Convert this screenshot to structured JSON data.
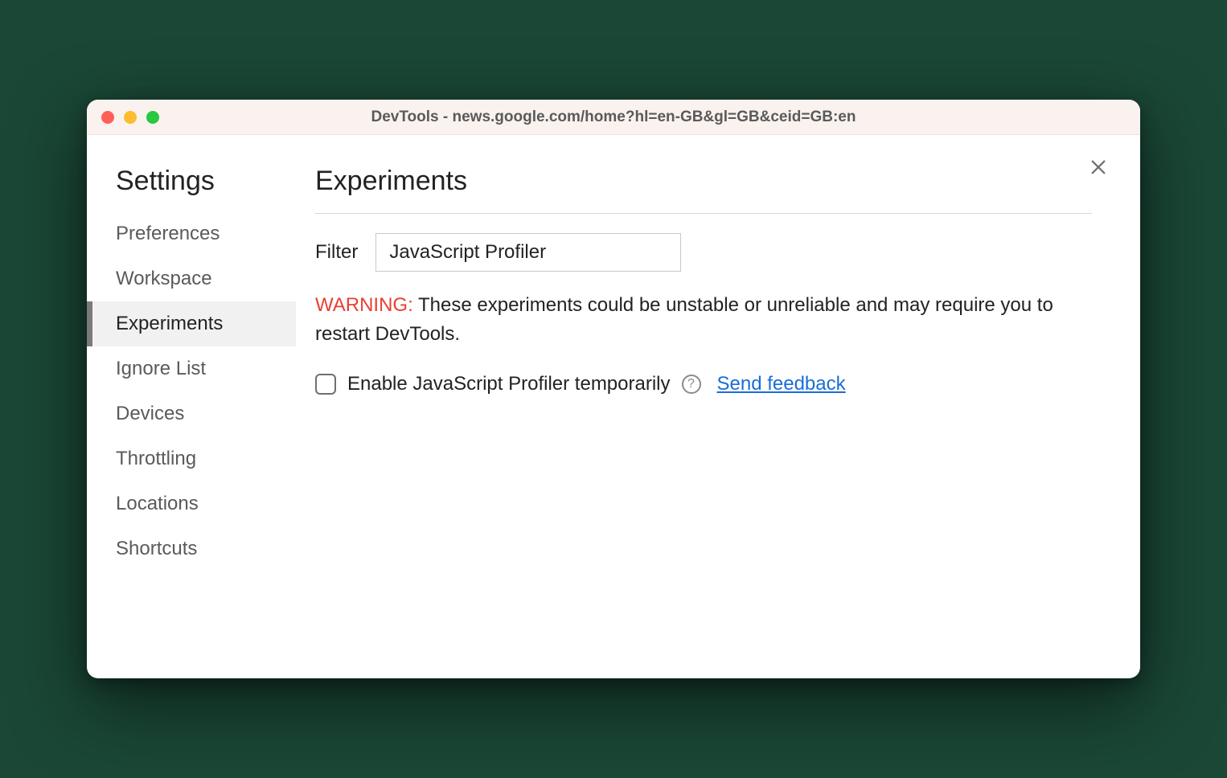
{
  "window": {
    "title": "DevTools - news.google.com/home?hl=en-GB&gl=GB&ceid=GB:en"
  },
  "sidebar": {
    "title": "Settings",
    "items": [
      {
        "label": "Preferences",
        "selected": false
      },
      {
        "label": "Workspace",
        "selected": false
      },
      {
        "label": "Experiments",
        "selected": true
      },
      {
        "label": "Ignore List",
        "selected": false
      },
      {
        "label": "Devices",
        "selected": false
      },
      {
        "label": "Throttling",
        "selected": false
      },
      {
        "label": "Locations",
        "selected": false
      },
      {
        "label": "Shortcuts",
        "selected": false
      }
    ]
  },
  "main": {
    "title": "Experiments",
    "filter_label": "Filter",
    "filter_value": "JavaScript Profiler",
    "warning_label": "WARNING:",
    "warning_text": " These experiments could be unstable or unreliable and may require you to restart DevTools.",
    "experiment": {
      "checked": false,
      "label": "Enable JavaScript Profiler temporarily",
      "help_glyph": "?",
      "feedback_link": "Send feedback"
    }
  }
}
